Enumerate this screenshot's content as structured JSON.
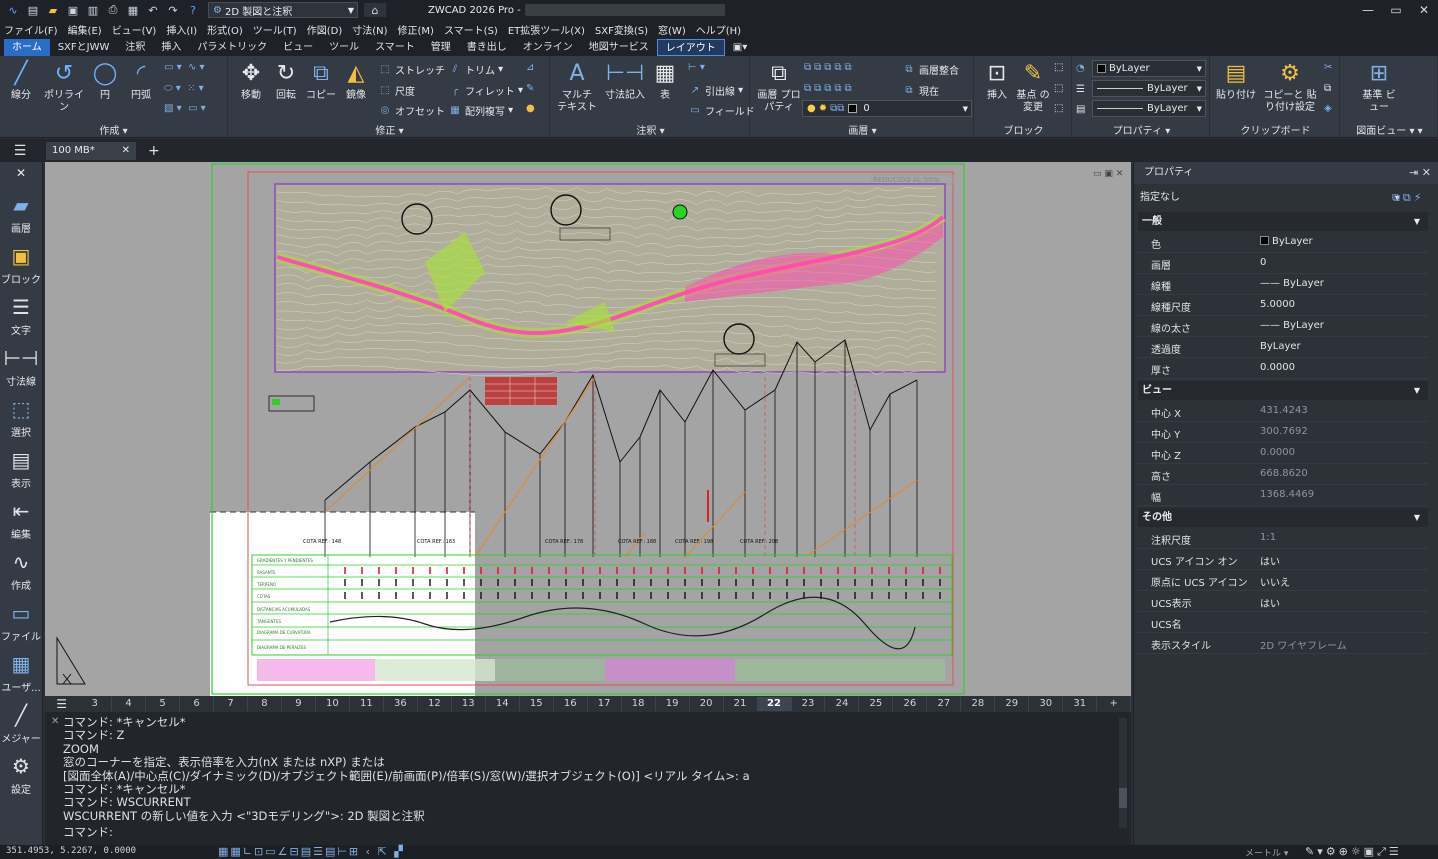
{
  "titlebar": {
    "workspace": "2D 製図と注釈",
    "app_title": "ZWCAD 2026 Pro -",
    "window_buttons": [
      "—",
      "▭",
      "✕"
    ]
  },
  "menu": [
    "ファイル(F)",
    "編集(E)",
    "ビュー(V)",
    "挿入(I)",
    "形式(O)",
    "ツール(T)",
    "作図(D)",
    "寸法(N)",
    "修正(M)",
    "スマート(S)",
    "ET拡張ツール(X)",
    "SXF変換(S)",
    "窓(W)",
    "ヘルプ(H)"
  ],
  "ribbon_tabs": [
    "ホーム",
    "SXFとJWW",
    "注釈",
    "挿入",
    "パラメトリック",
    "ビュー",
    "ツール",
    "スマート",
    "管理",
    "書き出し",
    "オンライン",
    "地図サービス",
    "レイアウト"
  ],
  "ribbon": {
    "draw": {
      "title": "作成",
      "line": "線分",
      "polyline": "ポリライン",
      "circle": "円",
      "arc": "円弧"
    },
    "modify": {
      "title": "修正",
      "move": "移動",
      "rotate": "回転",
      "copy": "コピー",
      "mirror": "鏡像",
      "stretch": "ストレッチ",
      "scale": "尺度",
      "offset": "オフセット",
      "trim": "トリム",
      "fillet": "フィレット",
      "array": "配列複写"
    },
    "annotation": {
      "title": "注釈",
      "mtext": "マルチ テキスト",
      "dim": "寸法記入",
      "table": "表",
      "leader": "引出線",
      "field": "フィールド"
    },
    "layers": {
      "title": "画層",
      "props": "画層 プロパティ",
      "match": "画層整合",
      "current": "現在",
      "layer_value": "0"
    },
    "block": {
      "title": "ブロック",
      "insert": "挿入",
      "edit_base": "基点 の変更"
    },
    "properties": {
      "title": "プロパティ",
      "color": "ByLayer",
      "linetype": "ByLayer",
      "lineweight": "ByLayer"
    },
    "clipboard": {
      "title": "クリップボード",
      "paste": "貼り付け",
      "copy_paste": "コピーと 貼り付け設定"
    },
    "view": {
      "title": "図面ビュー",
      "base": "基準 ビュー"
    }
  },
  "doc_tab": {
    "name": "100 MB*"
  },
  "left_toolbar": [
    "画層",
    "ブロック",
    "文字",
    "寸法線",
    "選択",
    "表示",
    "編集",
    "作成",
    "ファイル",
    "ユーザ...",
    "メジャー",
    "設定"
  ],
  "drawing": {
    "stamp": "REDUCIDO AL 50%",
    "stations": [
      "COTA REF.: 148",
      "COTA REF.: 163",
      "COTA REF.: 178",
      "COTA REF.: 188",
      "COTA REF.: 198",
      "COTA REF.: 208"
    ],
    "profile_rows": [
      "GRADIENTES Y PENDIENTES",
      "RASANTE",
      "TERRENO",
      "COTAS",
      "DISTANCIAS ACUMULADAS",
      "TANGENTES",
      "DIAGRAMA DE CURVATURA",
      "DIAGRAMA DE PERALTES"
    ]
  },
  "sheet_tabs": [
    "3",
    "4",
    "5",
    "6",
    "7",
    "8",
    "9",
    "10",
    "11",
    "36",
    "12",
    "13",
    "14",
    "15",
    "16",
    "17",
    "18",
    "19",
    "20",
    "21",
    "22",
    "23",
    "24",
    "25",
    "26",
    "27",
    "28",
    "29",
    "30",
    "31",
    "+"
  ],
  "sheet_active": "22",
  "command": {
    "lines": [
      "コマンド: *キャンセル*",
      "コマンド: Z",
      "ZOOM",
      "窓のコーナーを指定、表示倍率を入力(nX または nXP) または",
      "[図面全体(A)/中心点(C)/ダイナミック(D)/オブジェクト範囲(E)/前画面(P)/倍率(S)/窓(W)/選択オブジェクト(O)] <リアル タイム>: a",
      "コマンド: *キャンセル*",
      "コマンド: WSCURRENT",
      "WSCURRENT の新しい値を入力 <\"3Dモデリング\">: 2D 製図と注釈"
    ],
    "prompt": "コマンド:"
  },
  "properties": {
    "title": "プロパティ",
    "selection": "指定なし",
    "sections": {
      "general": "一般",
      "view": "ビュー",
      "misc": "その他"
    },
    "general": [
      {
        "k": "色",
        "v": "ByLayer",
        "type": "color"
      },
      {
        "k": "画層",
        "v": "0"
      },
      {
        "k": "線種",
        "v": "—— ByLayer"
      },
      {
        "k": "線種尺度",
        "v": "5.0000"
      },
      {
        "k": "線の太さ",
        "v": "—— ByLayer"
      },
      {
        "k": "透過度",
        "v": "ByLayer"
      },
      {
        "k": "厚さ",
        "v": "0.0000"
      }
    ],
    "view": [
      {
        "k": "中心 X",
        "v": "431.4243"
      },
      {
        "k": "中心 Y",
        "v": "300.7692"
      },
      {
        "k": "中心 Z",
        "v": "0.0000"
      },
      {
        "k": "高さ",
        "v": "668.8620"
      },
      {
        "k": "幅",
        "v": "1368.4469"
      }
    ],
    "misc": [
      {
        "k": "注釈尺度",
        "v": "1:1"
      },
      {
        "k": "UCS アイコン オン",
        "v": "はい"
      },
      {
        "k": "原点に UCS アイコン",
        "v": "いいえ"
      },
      {
        "k": "UCS表示",
        "v": "はい"
      },
      {
        "k": "UCS名",
        "v": ""
      },
      {
        "k": "表示スタイル",
        "v": "2D ワイヤフレーム"
      }
    ]
  },
  "status": {
    "coords": "351.4953, 5.2267, 0.0000",
    "units": "メートル"
  },
  "colors": {
    "accent": "#2b6cc4",
    "terrain_bg": "#b0ad9a",
    "road_pink": "#ff4fb0",
    "road_fill": "#a8e23a",
    "viewport_green": "#2bd12b"
  },
  "icons": {
    "title": [
      "app-logo-icon",
      "new-icon",
      "open-icon",
      "save-icon",
      "print-icon",
      "undo-icon",
      "redo-icon",
      "help-icon"
    ],
    "layer_status": [
      "bulb-icon",
      "sun-icon",
      "lock-icon"
    ]
  }
}
